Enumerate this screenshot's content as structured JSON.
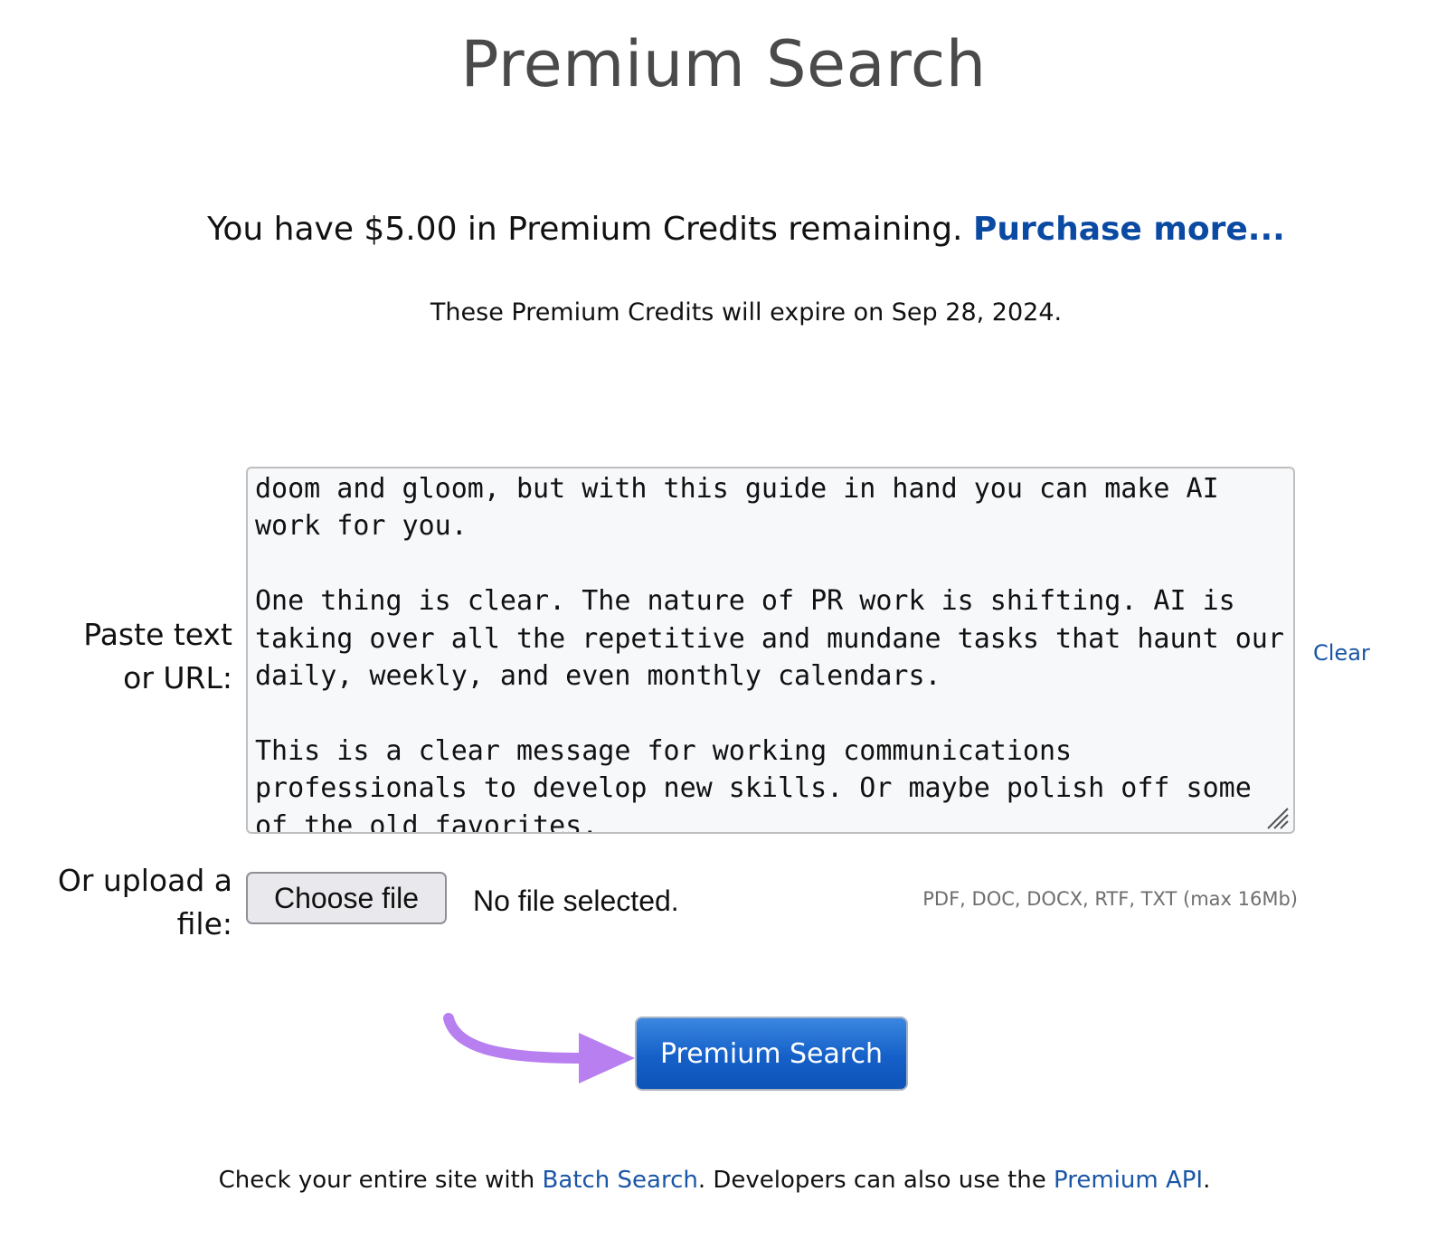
{
  "page": {
    "title": "Premium Search"
  },
  "credits": {
    "text": "You have $5.00 in Premium Credits remaining.",
    "purchase_link": "Purchase more...",
    "expiry_text": "These Premium Credits will expire on Sep 28, 2024."
  },
  "form": {
    "paste_label_line1": "Paste text",
    "paste_label_line2": "or URL:",
    "textarea_value": "doom and gloom, but with this guide in hand you can make AI work for you.\n\nOne thing is clear. The nature of PR work is shifting. AI is taking over all the repetitive and mundane tasks that haunt our daily, weekly, and even monthly calendars.\n\nThis is a clear message for working communications professionals to develop new skills. Or maybe polish off some of the old favorites.",
    "clear_link": "Clear",
    "upload_label_line1": "Or upload a",
    "upload_label_line2": "file:",
    "choose_file_label": "Choose file",
    "no_file_text": "No file selected.",
    "allowed_formats": "PDF, DOC, DOCX, RTF, TXT (max 16Mb)",
    "submit_label": "Premium Search"
  },
  "annotation": {
    "arrow_color": "#b77ff0"
  },
  "footer": {
    "text_before": "Check your entire site with ",
    "batch_link": "Batch Search",
    "text_middle": ". Developers can also use the ",
    "api_link": "Premium API",
    "text_after": "."
  }
}
